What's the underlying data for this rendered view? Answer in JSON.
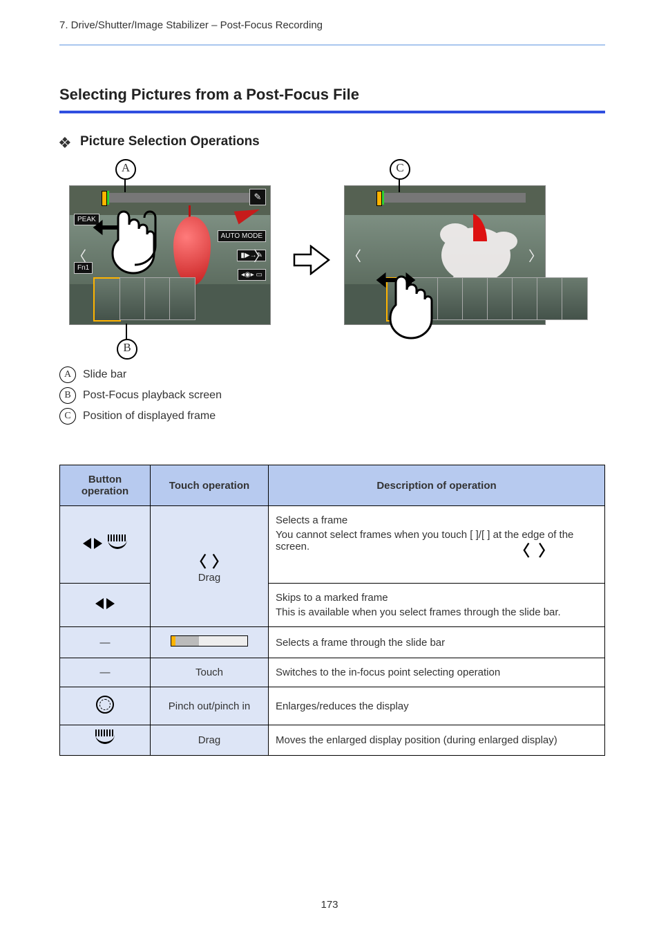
{
  "header": {
    "category": "7. Drive/Shutter/Image Stabilizer – Post-Focus Recording"
  },
  "section": {
    "title": "Selecting Pictures from a Post-Focus File",
    "subtitle": "Picture Selection Operations"
  },
  "callouts": {
    "a": "A",
    "b": "B",
    "c": "C"
  },
  "legend": {
    "a": "Slide bar",
    "b": "Post-Focus playback screen",
    "c": "Position of displayed frame"
  },
  "screen": {
    "peak": "PEAK",
    "fn1": "Fn1",
    "mode": "AUTO MODE",
    "pen": "✎"
  },
  "arrow_label": "",
  "table": {
    "headers": {
      "button": "Button operation",
      "touch": "Touch operation",
      "desc": "Description of operation"
    },
    "rows": [
      {
        "btn_html": "tri-dial",
        "touch_html": "chev-drag",
        "desc_line1": "Selects a frame",
        "desc_line2": "You cannot select frames when you touch [  ]/[  ] at the edge of the screen."
      },
      {
        "btn_html": "tri",
        "touch_html": "chev-drag",
        "desc_line1": "Skips to a marked frame",
        "desc_line2": "This is available when you select frames through the slide bar."
      },
      {
        "btn_html": "",
        "touch_html": "slider",
        "desc_line1": "Selects a frame through the slide bar",
        "desc_line2": ""
      },
      {
        "btn_html": "",
        "touch_html": "touch",
        "touch_text": "Touch",
        "desc_line1": "Switches to the in-focus point selecting operation",
        "desc_line2": ""
      },
      {
        "btn_html": "wheel",
        "touch_html": "pinch",
        "touch_text": "Pinch out/pinch in",
        "desc_line1": "Enlarges/reduces the display",
        "desc_line2": ""
      },
      {
        "btn_html": "dial",
        "touch_html": "drag",
        "touch_text": "Drag",
        "desc_line1": "Moves the enlarged display position (during enlarged display)",
        "desc_line2": ""
      }
    ]
  },
  "page_number": "173"
}
